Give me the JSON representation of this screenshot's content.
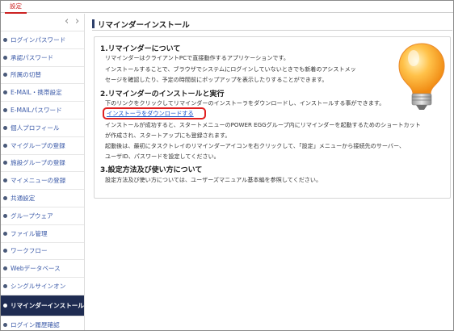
{
  "header": {
    "tab_label": "設定"
  },
  "sidebar": {
    "prev_symbol": "‹",
    "next_symbol": "›",
    "items": [
      {
        "label": "ログインパスワード",
        "active": false
      },
      {
        "label": "承認パスワード",
        "active": false
      },
      {
        "label": "所属の切替",
        "active": false
      },
      {
        "label": "E-MAIL・携帯設定",
        "active": false
      },
      {
        "label": "E-MAILパスワード",
        "active": false
      },
      {
        "label": "個人プロフィール",
        "active": false
      },
      {
        "label": "マイグループの登録",
        "active": false
      },
      {
        "label": "施設グループの登録",
        "active": false
      },
      {
        "label": "マイメニューの登録",
        "active": false
      },
      {
        "label": "共通設定",
        "active": false
      },
      {
        "label": "グループウェア",
        "active": false
      },
      {
        "label": "ファイル管理",
        "active": false
      },
      {
        "label": "ワークフロー",
        "active": false
      },
      {
        "label": "Webデータベース",
        "active": false
      },
      {
        "label": "シングルサインオン",
        "active": false
      },
      {
        "label": "リマインダーインストール",
        "active": true
      },
      {
        "label": "ログイン履歴確認",
        "active": false
      }
    ]
  },
  "main": {
    "title": "リマインダーインストール",
    "sections": [
      {
        "heading": "1.リマインダーについて",
        "lines": [
          "リマインダーはクライアントPCで直接動作するアプリケーションです。",
          "インストールすることで、ブラウザでシステムにログインしていないときでも新着のアシストメッ",
          "セージを確認したり、予定の時間前にポップアップを表示したりすることができます。"
        ]
      },
      {
        "heading": "2.リマインダーのインストールと実行",
        "lines_before": [
          "下のリンクをクリックしてリマインダーのインストーラをダウンロードし、インストールする事ができます。"
        ],
        "download_link": "インストーラをダウンロードする",
        "lines_after": [
          "インストールが成功すると、スタートメニューのPOWER EGGグループ内にリマインダーを起動するためのショートカット",
          "が作成され、スタートアップにも登録されます。",
          "起動後は、最初にタスクトレイのリマインダーアイコンを右クリックして、「設定」メニューから接続先のサーバー、",
          "ユーザID、パスワードを設定してください。"
        ]
      },
      {
        "heading": "3.設定方法及び使い方について",
        "lines": [
          "設定方法及び使い方については、ユーザーズマニュアル基本編を参照してください。"
        ]
      }
    ]
  },
  "colors": {
    "accent_red": "#cc2222",
    "active_nav": "#1f2c52",
    "link_blue": "#1a55cc",
    "highlight_border": "#e02020"
  },
  "icons": {
    "illustration": "lightbulb-icon",
    "nav_bullet": "bullet-icon"
  }
}
